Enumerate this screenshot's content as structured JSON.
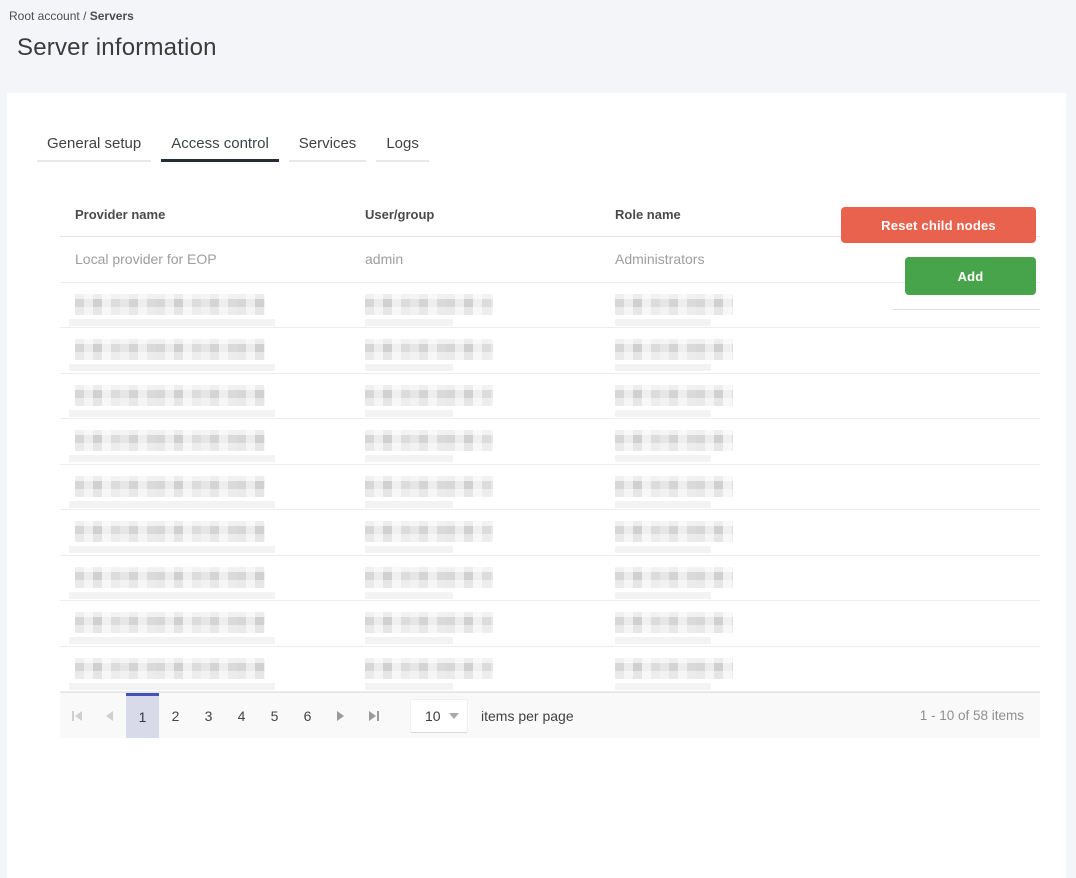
{
  "breadcrumb": {
    "root": "Root account",
    "separator": "/",
    "current": "Servers"
  },
  "title": "Server information",
  "tabs": [
    {
      "label": "General setup",
      "active": false
    },
    {
      "label": "Access control",
      "active": true
    },
    {
      "label": "Services",
      "active": false
    },
    {
      "label": "Logs",
      "active": false
    }
  ],
  "toolbar": {
    "reset_label": "Reset child nodes",
    "add_label": "Add"
  },
  "table": {
    "columns": [
      "Provider name",
      "User/group",
      "Role name"
    ],
    "rows": [
      {
        "provider": "Local provider for EOP",
        "user": "admin",
        "role": "Administrators"
      }
    ],
    "redacted_row_count": 9
  },
  "pagination": {
    "pages": [
      "1",
      "2",
      "3",
      "4",
      "5",
      "6"
    ],
    "current_page": "1",
    "page_size": "10",
    "items_per_page_label": "items per page",
    "range_label": "1 - 10 of 58 items"
  },
  "colors": {
    "page_background": "#f4f5f8",
    "reset_button": "#e8624e",
    "add_button": "#47a44b",
    "active_tab_underline": "#262b38",
    "selected_page_background": "#d8daea",
    "selected_page_border": "#4453b8"
  }
}
